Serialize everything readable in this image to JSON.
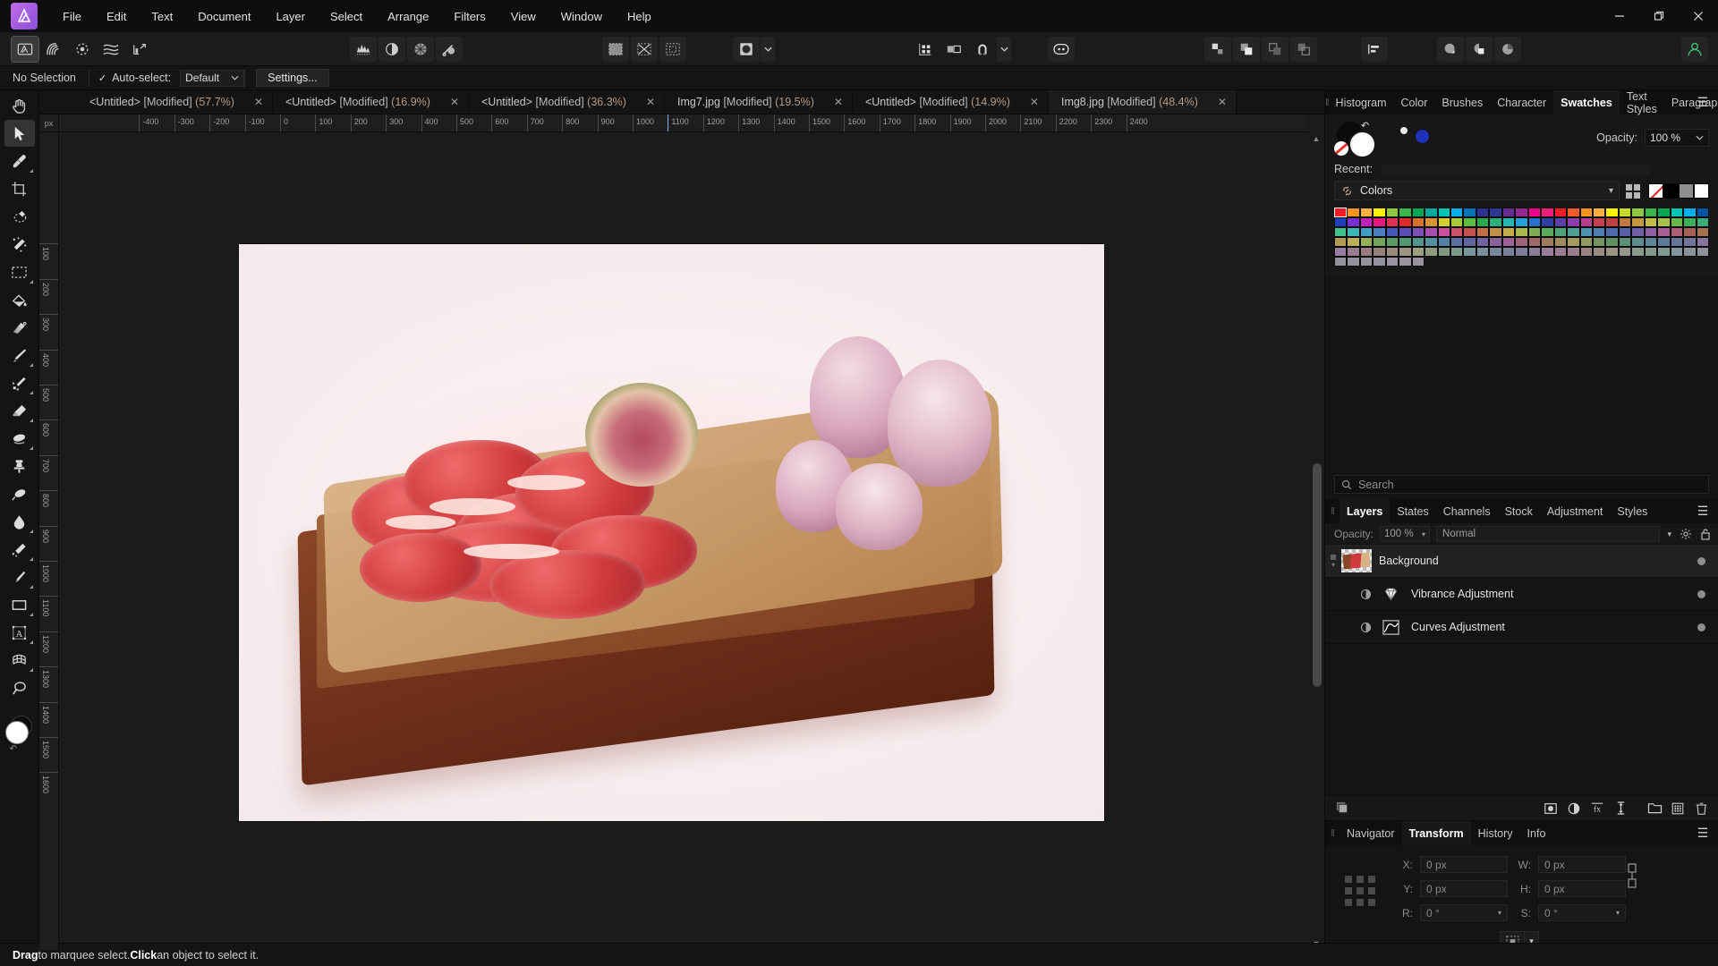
{
  "app": {
    "name": "Affinity Photo",
    "logo_text": "A"
  },
  "menubar": {
    "items": [
      "File",
      "Edit",
      "Text",
      "Document",
      "Layer",
      "Select",
      "Arrange",
      "Filters",
      "View",
      "Window",
      "Help"
    ]
  },
  "window_controls": {
    "minimize": "—",
    "maximize": "❐",
    "close": "✕"
  },
  "toolbar": {
    "groups": [
      {
        "name": "persona",
        "buttons": [
          {
            "icon": "photo-persona-icon",
            "label": "Photo Persona"
          },
          {
            "icon": "liquify-persona-icon",
            "label": "Liquify Persona"
          },
          {
            "icon": "develop-persona-icon",
            "label": "Develop Persona"
          },
          {
            "icon": "tone-mapping-persona-icon",
            "label": "Tone Mapping Persona"
          },
          {
            "icon": "export-persona-icon",
            "label": "Export Persona"
          }
        ]
      },
      {
        "name": "adjustments",
        "buttons": [
          {
            "icon": "histogram-icon",
            "label": "Levels"
          },
          {
            "icon": "contrast-icon",
            "label": "Brightness / Contrast"
          },
          {
            "icon": "color-wheel-icon",
            "label": "Color Balance"
          },
          {
            "icon": "dodge-burn-icon",
            "label": "Dodge and Burn"
          }
        ]
      },
      {
        "name": "mask",
        "buttons": [
          {
            "icon": "refine-mask-icon",
            "label": "Refine Mask"
          },
          {
            "icon": "invert-selection-icon",
            "label": "Invert Selection"
          },
          {
            "icon": "selection-from-layer-icon",
            "label": "Selection From Layer"
          }
        ]
      },
      {
        "name": "brush",
        "buttons": [
          {
            "icon": "brush-preview-icon",
            "label": "Brush"
          },
          {
            "icon": "chevron-down-icon",
            "label": "Brush Options"
          }
        ]
      },
      {
        "name": "snapping",
        "buttons": [
          {
            "icon": "grid-icon",
            "label": "Show Grid"
          },
          {
            "icon": "guides-icon",
            "label": "Show Guides"
          },
          {
            "icon": "magnet-icon",
            "label": "Enable Snapping"
          },
          {
            "icon": "chevron-down-icon",
            "label": "Snapping Options"
          }
        ]
      },
      {
        "name": "assistant",
        "buttons": [
          {
            "icon": "assistant-icon",
            "label": "Assistant Manager"
          }
        ]
      },
      {
        "name": "geometry",
        "buttons": [
          {
            "icon": "separate-icon",
            "label": "Separate Curves"
          },
          {
            "icon": "add-shape-icon",
            "label": "Add"
          },
          {
            "icon": "subtract-shape-icon",
            "label": "Subtract"
          },
          {
            "icon": "intersect-shape-icon",
            "label": "Intersect"
          }
        ]
      },
      {
        "name": "align",
        "buttons": [
          {
            "icon": "align-left-icon",
            "label": "Alignment"
          }
        ]
      },
      {
        "name": "blend",
        "buttons": [
          {
            "icon": "fill-shape-icon",
            "label": "Fill"
          },
          {
            "icon": "combine-icon",
            "label": "Combine"
          },
          {
            "icon": "pie-shape-icon",
            "label": "Pie"
          }
        ]
      }
    ],
    "account": {
      "icon": "account-icon",
      "color": "#3fbf74"
    }
  },
  "context_bar": {
    "selection_label": "No Selection",
    "auto_select_label": "Auto-select:",
    "auto_select_checked": true,
    "auto_select_value": "Default",
    "settings_label": "Settings..."
  },
  "tools": {
    "items": [
      {
        "name": "view-tool",
        "icon": "hand-icon",
        "selected": false,
        "has_flyout": false
      },
      {
        "name": "move-tool",
        "icon": "arrow-cursor-icon",
        "selected": true,
        "has_flyout": false
      },
      {
        "name": "colour-picker-tool",
        "icon": "eyedropper-icon",
        "selected": false,
        "has_flyout": true
      },
      {
        "name": "crop-tool",
        "icon": "crop-icon",
        "selected": false,
        "has_flyout": false
      },
      {
        "name": "selection-brush-tool",
        "icon": "selection-brush-icon",
        "selected": false,
        "has_flyout": false
      },
      {
        "name": "flood-select-tool",
        "icon": "magic-wand-icon",
        "selected": false,
        "has_flyout": false
      },
      {
        "name": "marquee-tool",
        "icon": "marquee-rect-icon",
        "selected": false,
        "has_flyout": true
      },
      {
        "name": "flood-fill-tool",
        "icon": "paint-bucket-icon",
        "selected": false,
        "has_flyout": false
      },
      {
        "name": "gradient-tool",
        "icon": "gradient-icon",
        "selected": false,
        "has_flyout": false
      },
      {
        "name": "paint-brush-tool",
        "icon": "paint-brush-icon",
        "selected": false,
        "has_flyout": true
      },
      {
        "name": "pixel-tool",
        "icon": "pixel-brush-icon",
        "selected": false,
        "has_flyout": true
      },
      {
        "name": "erase-brush-tool",
        "icon": "eraser-icon",
        "selected": false,
        "has_flyout": true
      },
      {
        "name": "blur-brush-tool",
        "icon": "smudge-icon",
        "selected": false,
        "has_flyout": true
      },
      {
        "name": "clone-brush-tool",
        "icon": "clone-stamp-icon",
        "selected": false,
        "has_flyout": false
      },
      {
        "name": "inpainting-brush-tool",
        "icon": "inpainting-icon",
        "selected": false,
        "has_flyout": false
      },
      {
        "name": "dodge-brush-tool",
        "icon": "dodge-icon",
        "selected": false,
        "has_flyout": true
      },
      {
        "name": "sponge-brush-tool",
        "icon": "sponge-icon",
        "selected": false,
        "has_flyout": true
      },
      {
        "name": "pen-tool",
        "icon": "pen-nib-icon",
        "selected": false,
        "has_flyout": true
      },
      {
        "name": "rectangle-tool",
        "icon": "rectangle-icon",
        "selected": false,
        "has_flyout": true
      },
      {
        "name": "artistic-text-tool",
        "icon": "text-frame-icon",
        "selected": false,
        "has_flyout": true
      },
      {
        "name": "mesh-warp-tool",
        "icon": "mesh-warp-icon",
        "selected": false,
        "has_flyout": true
      },
      {
        "name": "zoom-tool",
        "icon": "magnifier-icon",
        "selected": false,
        "has_flyout": false
      }
    ],
    "colour_well": {
      "foreground": "#ffffff",
      "background": "#0b0b0b",
      "swap_icon": "swap-colours-icon"
    }
  },
  "document_tabs": [
    {
      "title": "<Untitled>",
      "state": "[Modified]",
      "zoom": "(57.7%)",
      "active": false
    },
    {
      "title": "<Untitled>",
      "state": "[Modified]",
      "zoom": "(16.9%)",
      "active": false
    },
    {
      "title": "<Untitled>",
      "state": "[Modified]",
      "zoom": "(36.3%)",
      "active": false
    },
    {
      "title": "Img7.jpg",
      "state": "[Modified]",
      "zoom": "(19.5%)",
      "active": false
    },
    {
      "title": "<Untitled>",
      "state": "[Modified]",
      "zoom": "(14.9%)",
      "active": false
    },
    {
      "title": "Img8.jpg",
      "state": "[Modified]",
      "zoom": "(48.4%)",
      "active": true
    }
  ],
  "rulers": {
    "unit": "px",
    "h_ticks": [
      "-400",
      "-300",
      "-200",
      "-100",
      "0",
      "100",
      "200",
      "300",
      "400",
      "500",
      "600",
      "700",
      "800",
      "900",
      "1000",
      "1100",
      "1200",
      "1300",
      "1400",
      "1500",
      "1600",
      "1700",
      "1800",
      "1900",
      "2000",
      "2100",
      "2200",
      "2300",
      "2400"
    ],
    "v_ticks": [
      "100",
      "200",
      "300",
      "400",
      "500",
      "600",
      "700",
      "800",
      "900",
      "1000",
      "1100",
      "1200",
      "1300",
      "1400",
      "1500",
      "1600"
    ]
  },
  "right_panel": {
    "top_tabs": [
      {
        "label": "Histogram",
        "active": false
      },
      {
        "label": "Color",
        "active": false
      },
      {
        "label": "Brushes",
        "active": false
      },
      {
        "label": "Character",
        "active": false
      },
      {
        "label": "Swatches",
        "active": true
      },
      {
        "label": "Text Styles",
        "active": false
      },
      {
        "label": "Paragraph",
        "active": false
      }
    ],
    "menu_icon": "hamburger-icon",
    "swatches": {
      "opacity_label": "Opacity:",
      "opacity_value": "100 %",
      "recent_label": "Recent:",
      "palette_name": "Colors",
      "palette_icon": "link-icon",
      "add_swatch_icon": "add-swatch-icon",
      "kind_icons": [
        "none-swatch-icon",
        "black-swatch-icon",
        "gray-swatch-icon",
        "white-swatch-icon"
      ],
      "colors": [
        "#ee1c24",
        "#f7941e",
        "#fbb040",
        "#fff200",
        "#8dc63f",
        "#39b54a",
        "#00a651",
        "#00a99d",
        "#00c4b3",
        "#00aeef",
        "#0072bc",
        "#2e3192",
        "#2b3990",
        "#662d91",
        "#92278f",
        "#ec008c",
        "#ed1e79",
        "#ee1c24",
        "#f15a29",
        "#f7941e",
        "#fbb040",
        "#fff200",
        "#c7d92d",
        "#8dc63f",
        "#39b54a",
        "#00a651",
        "#00c4b3",
        "#00aeef",
        "#0054a6",
        "#1c3fbb",
        "#7b2fd0",
        "#c21fb8",
        "#e8197e",
        "#e03255",
        "#dd2a2a",
        "#d4712f",
        "#d69535",
        "#cfcf30",
        "#a8c93a",
        "#5abf42",
        "#2aa84c",
        "#2bb07c",
        "#25b7b0",
        "#2a9fd6",
        "#2a6fc9",
        "#2f3fa0",
        "#5b3fa8",
        "#8a3fa8",
        "#b53f8e",
        "#c3414f",
        "#c14040",
        "#c07a3d",
        "#c2993f",
        "#c2bb45",
        "#a9c04a",
        "#6ab64d",
        "#3fae5a",
        "#3cac78",
        "#40c08a",
        "#3fb4b4",
        "#3f9ec4",
        "#4a7fc0",
        "#4559b6",
        "#5a4fb6",
        "#7d4fb6",
        "#a94fb2",
        "#c9509a",
        "#cb506a",
        "#c3524f",
        "#c06f45",
        "#c08f47",
        "#c2ac4c",
        "#a8b84f",
        "#7fae52",
        "#5aa85c",
        "#4fa478",
        "#4e9f96",
        "#4e93ad",
        "#4d7fb2",
        "#4d6aad",
        "#5761a8",
        "#6f5fa8",
        "#8f5fa5",
        "#a85f95",
        "#ab5f72",
        "#a66057",
        "#a5734f",
        "#b49a52",
        "#b9b057",
        "#96ae58",
        "#73a45c",
        "#5b9c63",
        "#539874",
        "#52948c",
        "#55909f",
        "#5681a4",
        "#5a70a0",
        "#5f63a0",
        "#7263a0",
        "#8a639d",
        "#9d6396",
        "#a06479",
        "#a06a6a",
        "#a07a5f",
        "#a08b5d",
        "#a69a5c",
        "#8f9a60",
        "#74945f",
        "#609064",
        "#5f9078",
        "#5e8c8c",
        "#5e849a",
        "#5e789c",
        "#64749a",
        "#73749a",
        "#8a749a",
        "#9a7ba3",
        "#9a7b8f",
        "#9a7b80",
        "#97807b",
        "#9b8b7b",
        "#9c9480",
        "#9ca07e",
        "#8f9c7e",
        "#7f9a80",
        "#7a9a8c",
        "#79979a",
        "#79909a",
        "#79879a",
        "#7a809a",
        "#7e7d9a",
        "#8b7d9a",
        "#9a7d9a",
        "#9a7d93",
        "#9a7d8c",
        "#9a8283",
        "#9a8b83",
        "#9a9383",
        "#96998a",
        "#8a9a8a",
        "#829a8c",
        "#7f9a92",
        "#7f969a",
        "#85929a",
        "#8f929a",
        "#93929a",
        "#93929f",
        "#93939f",
        "#9392a3",
        "#9a92a3",
        "#9a92a0",
        "#9a92a0"
      ],
      "selected_index": 0
    },
    "search": {
      "placeholder": "Search",
      "icon": "search-icon"
    },
    "layers_tabs": [
      {
        "label": "Layers",
        "active": true
      },
      {
        "label": "States",
        "active": false
      },
      {
        "label": "Channels",
        "active": false
      },
      {
        "label": "Stock",
        "active": false
      },
      {
        "label": "Adjustment",
        "active": false
      },
      {
        "label": "Styles",
        "active": false
      }
    ],
    "layer_options": {
      "opacity_label": "Opacity:",
      "opacity_value": "100 %",
      "blend_mode": "Normal",
      "gear_icon": "gear-icon",
      "lock_icon": "lock-icon"
    },
    "layers": [
      {
        "name": "Background",
        "type": "pixel",
        "thumb": "image-thumb",
        "visible": true,
        "selected": true,
        "indent": false
      },
      {
        "name": "Vibrance Adjustment",
        "type": "adjustment",
        "icon": "vibrance-icon",
        "visible": true,
        "selected": false,
        "indent": true
      },
      {
        "name": "Curves Adjustment",
        "type": "adjustment",
        "icon": "curves-icon",
        "visible": true,
        "selected": false,
        "indent": true
      }
    ],
    "layer_footer_icons": [
      "layers-stack-icon",
      "mask-icon",
      "adjustment-icon",
      "live-filter-icon",
      "new-pixel-layer-icon",
      "group-icon",
      "new-layer-icon",
      "delete-icon"
    ],
    "bottom_tabs": [
      {
        "label": "Navigator",
        "active": false
      },
      {
        "label": "Transform",
        "active": true
      },
      {
        "label": "History",
        "active": false
      },
      {
        "label": "Info",
        "active": false
      }
    ],
    "transform": {
      "x_label": "X:",
      "x_value": "0 px",
      "y_label": "Y:",
      "y_value": "0 px",
      "w_label": "W:",
      "w_value": "0 px",
      "h_label": "H:",
      "h_value": "0 px",
      "r_label": "R:",
      "r_value": "0 °",
      "s_label": "S:",
      "s_value": "0 °",
      "link_icon": "link-ratio-icon",
      "anchor_icon": "anchor-point-icon",
      "mode_icon": "transform-mode-icon"
    }
  },
  "status_bar": {
    "prefix": "Drag",
    "text1": " to marquee select. ",
    "prefix2": "Click",
    "text2": " an object to select it."
  }
}
